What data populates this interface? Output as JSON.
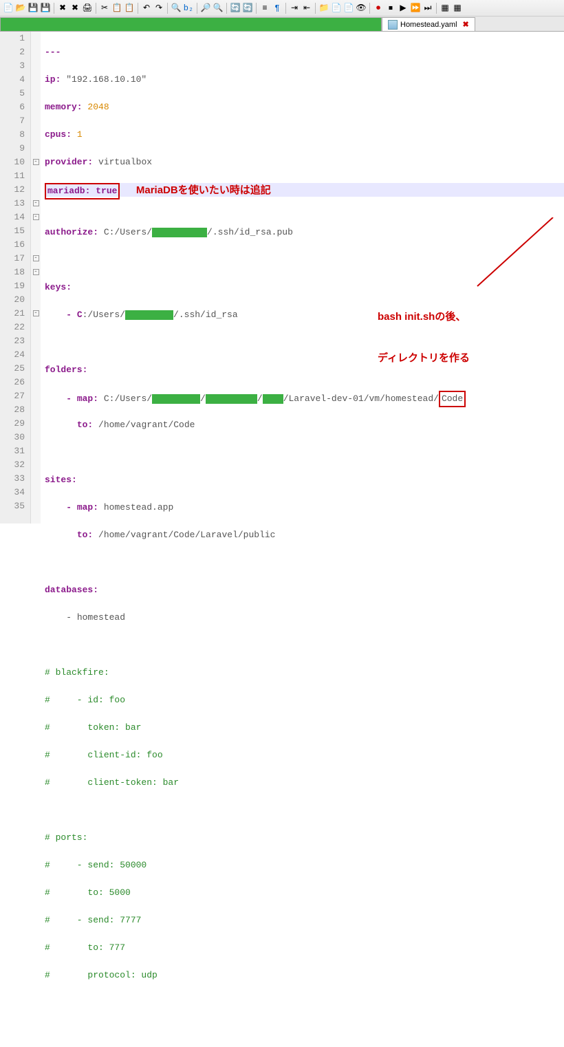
{
  "tabs": {
    "file_name": "Homestead.yaml"
  },
  "lines": {
    "1": "---",
    "2_key": "ip:",
    "2_val": "\"192.168.10.10\"",
    "3_key": "memory:",
    "3_val": "2048",
    "4_key": "cpus:",
    "4_val": "1",
    "5_key": "provider:",
    "5_val": "virtualbox",
    "6_key": "mariadb:",
    "6_val": "true",
    "8_key": "authorize:",
    "8_a": "C:/Users/",
    "8_b": "/.ssh/id_rsa.pub",
    "10_key": "keys:",
    "11_a": "- C",
    "11_b": ":/Users/",
    "11_c": "/.ssh/id_rsa",
    "13_key": "folders:",
    "14_key": "- map:",
    "14_a": "C:/Users/",
    "14_b": "/",
    "14_c": "/",
    "14_d": "/Laravel-dev-01/vm/homestead/",
    "14_e": "Code",
    "15_key": "to:",
    "15_val": "/home/vagrant/Code",
    "17_key": "sites:",
    "18_key": "- map:",
    "18_val": "homestead.app",
    "19_key": "to:",
    "19_val": "/home/vagrant/Code/Laravel/public",
    "21_key": "databases:",
    "22_val": "- homestead",
    "24": "# blackfire:",
    "25": "#     - id: foo",
    "26": "#       token: bar",
    "27": "#       client-id: foo",
    "28": "#       client-token: bar",
    "30": "# ports:",
    "31": "#     - send: 50000",
    "32": "#       to: 5000",
    "33": "#     - send: 7777",
    "34": "#       to: 777",
    "35": "#       protocol: udp"
  },
  "annotations": {
    "mariadb": "MariaDBを使いたい時は追記",
    "bash1": "bash init.shの後、",
    "bash2": "ディレクトリを作る"
  },
  "line_numbers": [
    "1",
    "2",
    "3",
    "4",
    "5",
    "6",
    "7",
    "8",
    "9",
    "10",
    "11",
    "12",
    "13",
    "14",
    "15",
    "16",
    "17",
    "18",
    "19",
    "20",
    "21",
    "22",
    "23",
    "24",
    "25",
    "26",
    "27",
    "28",
    "29",
    "30",
    "31",
    "32",
    "33",
    "34",
    "35"
  ]
}
